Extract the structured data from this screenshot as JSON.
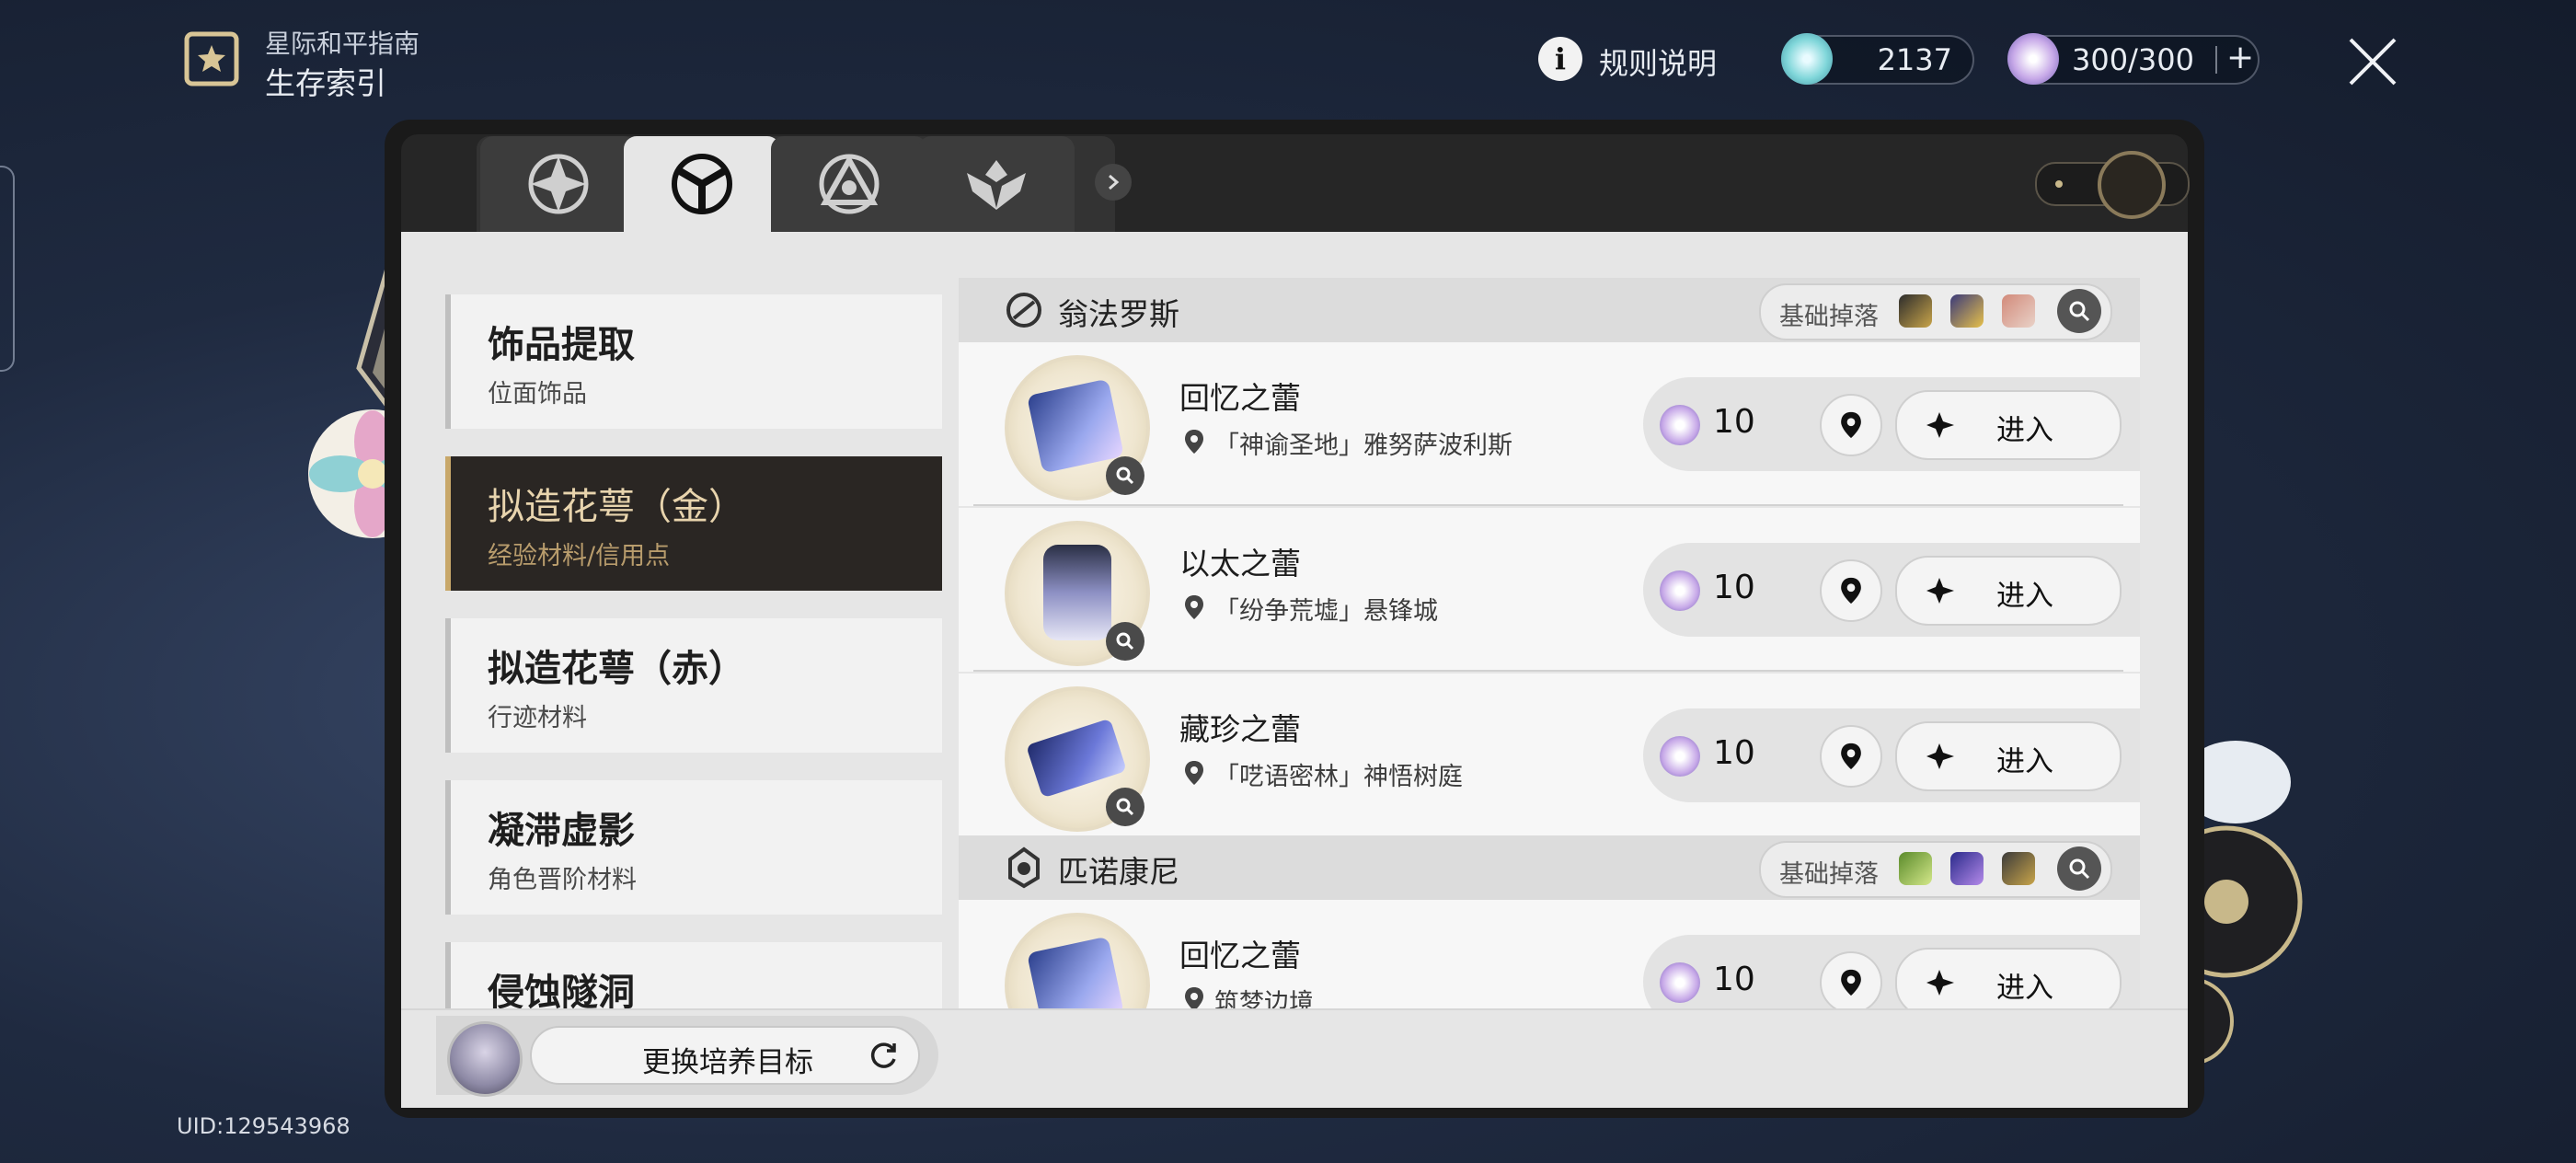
{
  "header": {
    "guide_title": "星际和平指南",
    "page_title": "生存索引",
    "rules_label": "规则说明",
    "currency_value": "2137",
    "stamina_value": "300/300",
    "stamina_plus": "+"
  },
  "tabs": [
    {
      "icon": "destruction-path-icon",
      "active": false
    },
    {
      "icon": "calyx-tab-icon",
      "active": true
    },
    {
      "icon": "stagnant-shadow-tab-icon",
      "active": false
    },
    {
      "icon": "cavern-tab-icon",
      "active": false
    }
  ],
  "categories": [
    {
      "title": "饰品提取",
      "subtitle": "位面饰品",
      "active": false
    },
    {
      "title": "拟造花萼（金）",
      "subtitle": "经验材料/信用点",
      "active": true
    },
    {
      "title": "拟造花萼（赤）",
      "subtitle": "行迹材料",
      "active": false
    },
    {
      "title": "凝滞虚影",
      "subtitle": "角色晋阶材料",
      "active": false
    },
    {
      "title": "侵蚀隧洞",
      "subtitle": "",
      "active": false
    }
  ],
  "worlds": [
    {
      "name": "翁法罗斯",
      "drop_label": "基础掉落",
      "entries": [
        {
          "title": "回忆之蕾",
          "location": "「神谕圣地」雅努萨波利斯",
          "cost": "10",
          "enter_label": "进入"
        },
        {
          "title": "以太之蕾",
          "location": "「纷争荒墟」悬锋城",
          "cost": "10",
          "enter_label": "进入"
        },
        {
          "title": "藏珍之蕾",
          "location": "「呓语密林」神悟树庭",
          "cost": "10",
          "enter_label": "进入"
        }
      ]
    },
    {
      "name": "匹诺康尼",
      "drop_label": "基础掉落",
      "entries": [
        {
          "title": "回忆之蕾",
          "location": "筑梦边境",
          "cost": "10",
          "enter_label": "进入"
        }
      ]
    }
  ],
  "footer": {
    "swap_label": "更换培养目标",
    "uid": "UID:129543968"
  },
  "colors": {
    "active_tab_text": "#e8d4ad",
    "active_border": "#c8a86a"
  }
}
